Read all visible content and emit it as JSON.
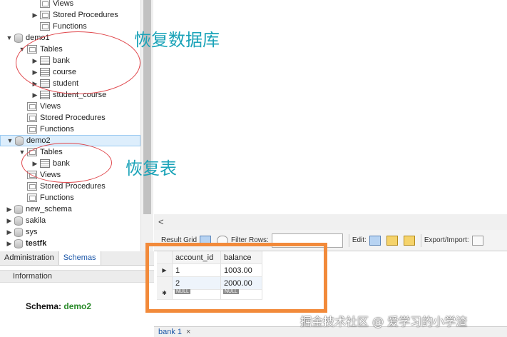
{
  "navigator": {
    "rows": [
      {
        "label": "Views",
        "type": "folder",
        "level": 2,
        "arrow": ""
      },
      {
        "label": "Stored Procedures",
        "type": "folder",
        "level": 2,
        "arrow": "▶"
      },
      {
        "label": "Functions",
        "type": "folder",
        "level": 2,
        "arrow": ""
      },
      {
        "label": "demo1",
        "type": "db",
        "level": 0,
        "arrow": "▼"
      },
      {
        "label": "Tables",
        "type": "folder",
        "level": 1,
        "arrow": "▼"
      },
      {
        "label": "bank",
        "type": "table",
        "level": 2,
        "arrow": "▶"
      },
      {
        "label": "course",
        "type": "table",
        "level": 2,
        "arrow": "▶"
      },
      {
        "label": "student",
        "type": "table",
        "level": 2,
        "arrow": "▶"
      },
      {
        "label": "student_course",
        "type": "table",
        "level": 2,
        "arrow": "▶"
      },
      {
        "label": "Views",
        "type": "folder",
        "level": 1,
        "arrow": ""
      },
      {
        "label": "Stored Procedures",
        "type": "folder",
        "level": 1,
        "arrow": ""
      },
      {
        "label": "Functions",
        "type": "folder",
        "level": 1,
        "arrow": ""
      },
      {
        "label": "demo2",
        "type": "db",
        "level": 0,
        "arrow": "▼",
        "selected": true
      },
      {
        "label": "Tables",
        "type": "folder",
        "level": 1,
        "arrow": "▼"
      },
      {
        "label": "bank",
        "type": "table",
        "level": 2,
        "arrow": "▶"
      },
      {
        "label": "Views",
        "type": "folder",
        "level": 1,
        "arrow": ""
      },
      {
        "label": "Stored Procedures",
        "type": "folder",
        "level": 1,
        "arrow": ""
      },
      {
        "label": "Functions",
        "type": "folder",
        "level": 1,
        "arrow": ""
      },
      {
        "label": "new_schema",
        "type": "db",
        "level": 0,
        "arrow": "▶"
      },
      {
        "label": "sakila",
        "type": "db",
        "level": 0,
        "arrow": "▶"
      },
      {
        "label": "sys",
        "type": "db",
        "level": 0,
        "arrow": "▶"
      },
      {
        "label": "testfk",
        "type": "db",
        "level": 0,
        "arrow": "▶",
        "bold": true
      }
    ]
  },
  "annotations": {
    "restore_db": "恢复数据库",
    "restore_table": "恢复表",
    "watermark": "掘金技术社区 @ 爱学习的小学渣"
  },
  "toolbar": {
    "result_grid_label": "Result Grid",
    "filter_label": "Filter Rows:",
    "edit_label": "Edit:",
    "export_label": "Export/Import:"
  },
  "grid": {
    "columns": [
      "account_id",
      "balance"
    ],
    "rows": [
      {
        "marker": "▶",
        "account_id": "1",
        "balance": "1003.00"
      },
      {
        "marker": "",
        "account_id": "2",
        "balance": "2000.00"
      }
    ],
    "new_row_marker": "✱",
    "null_tag": "NULL"
  },
  "left_tabs": {
    "administration": "Administration",
    "schemas": "Schemas"
  },
  "info": {
    "header": "Information",
    "schema_label": "Schema:",
    "schema_value": "demo2"
  },
  "bottom_tab": {
    "label": "bank 1",
    "close": "×"
  },
  "editor_scroll_arrow": "<"
}
